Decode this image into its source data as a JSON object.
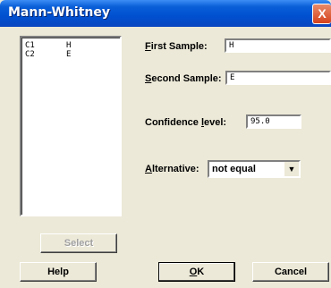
{
  "window": {
    "title": "Mann-Whitney",
    "close_glyph": "X"
  },
  "variables": [
    {
      "column": "C1",
      "name": "H"
    },
    {
      "column": "C2",
      "name": "E"
    }
  ],
  "form": {
    "first_sample": {
      "label_key": "F",
      "label_rest": "irst Sample:",
      "value": "H"
    },
    "second_sample": {
      "label_key": "S",
      "label_rest": "econd Sample:",
      "value": "E"
    },
    "confidence": {
      "label_pre": "Confidence ",
      "label_key": "l",
      "label_rest": "evel:",
      "value": "95.0"
    },
    "alternative": {
      "label_key": "A",
      "label_rest": "lternative:",
      "selected": "not equal"
    }
  },
  "buttons": {
    "select": "Select",
    "help": "Help",
    "ok_key": "O",
    "ok_rest": "K",
    "cancel": "Cancel"
  },
  "icons": {
    "dropdown_arrow": "chevron-down-icon",
    "close": "close-icon"
  }
}
